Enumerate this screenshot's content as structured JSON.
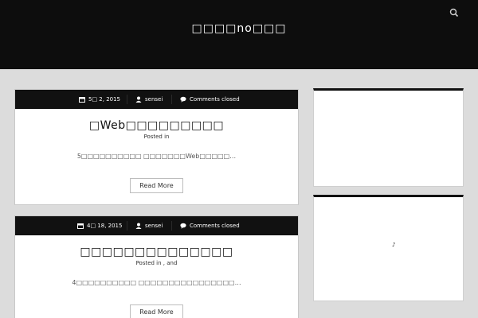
{
  "site": {
    "title": "□□□□no□□□"
  },
  "posts": [
    {
      "date": "5□ 2, 2015",
      "author": "sensei",
      "comments": "Comments closed",
      "title": "□Web□□□□□□□□□",
      "posted_in": "Posted in",
      "excerpt": "5□□□□□□□□□□ □□□□□□□Web□□□□□…",
      "read_more": "Read More"
    },
    {
      "date": "4□ 18, 2015",
      "author": "sensei",
      "comments": "Comments closed",
      "title": "□□□□□□□□□□□□□□",
      "posted_in": "Posted in      , and",
      "excerpt": "4□□□□□□□□□□ □□□□□□□□□□□□□□□□…",
      "read_more": "Read More"
    }
  ],
  "sidebar": {
    "widget2_glyph": "♪"
  },
  "icons": {
    "search": "search-icon",
    "date": "calendar-icon",
    "author": "user-icon",
    "comments": "comment-icon"
  }
}
